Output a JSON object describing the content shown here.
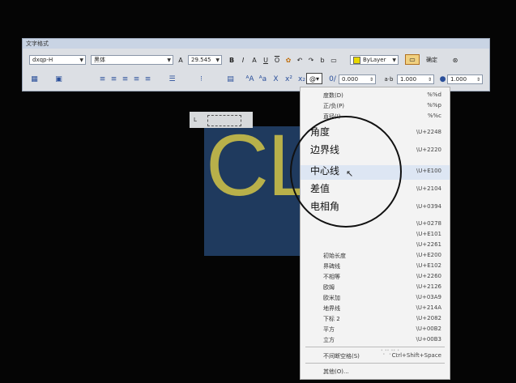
{
  "toolbar": {
    "title": "文字格式",
    "style_value": "dxqp-H",
    "font_value": "黑体",
    "height_value": "29.545",
    "bold": "B",
    "italic": "I",
    "strike": "A",
    "underline": "U",
    "overline": "O",
    "color_value": "ByLayer",
    "ok_label": "确定",
    "oblique_value": "0.000",
    "tracking_label": "a·b",
    "tracking_value": "1.000",
    "width_value": "1.000"
  },
  "text_content": "CL",
  "menu": {
    "items": [
      {
        "label": "度数(D)",
        "code": "%%d",
        "big": false
      },
      {
        "label": "正/负(P)",
        "code": "%%p",
        "big": false
      },
      {
        "label": "直径(I)",
        "code": "%%c",
        "big": false
      },
      {
        "label": "角度",
        "code": "\\U+2248",
        "big": true
      },
      {
        "label": "边界线",
        "code": "\\U+2220",
        "big": true
      },
      {
        "label": "中心线",
        "code": "\\U+E100",
        "big": true,
        "highlight": true
      },
      {
        "label": "差值",
        "code": "\\U+2104",
        "big": true
      },
      {
        "label": "电相角",
        "code": "\\U+0394",
        "big": true
      },
      {
        "label": "",
        "code": "\\U+0278",
        "big": false
      },
      {
        "label": "",
        "code": "\\U+E101",
        "big": false
      },
      {
        "label": "",
        "code": "\\U+2261",
        "big": false
      },
      {
        "label": "初始长度",
        "code": "\\U+E200",
        "big": false
      },
      {
        "label": "界碑线",
        "code": "\\U+E102",
        "big": false
      },
      {
        "label": "不相等",
        "code": "\\U+2260",
        "big": false
      },
      {
        "label": "欧姆",
        "code": "\\U+2126",
        "big": false
      },
      {
        "label": "欧米加",
        "code": "\\U+03A9",
        "big": false
      },
      {
        "label": "地界线",
        "code": "\\U+214A",
        "big": false
      },
      {
        "label": "下标 2",
        "code": "\\U+2082",
        "big": false
      },
      {
        "label": "平方",
        "code": "\\U+00B2",
        "big": false
      },
      {
        "label": "立方",
        "code": "\\U+00B3",
        "big": false
      },
      {
        "label": "不间断空格(S)",
        "code": "Ctrl+Shift+Space",
        "big": false
      },
      {
        "label": "其他(O)...",
        "code": "",
        "big": false
      }
    ]
  }
}
